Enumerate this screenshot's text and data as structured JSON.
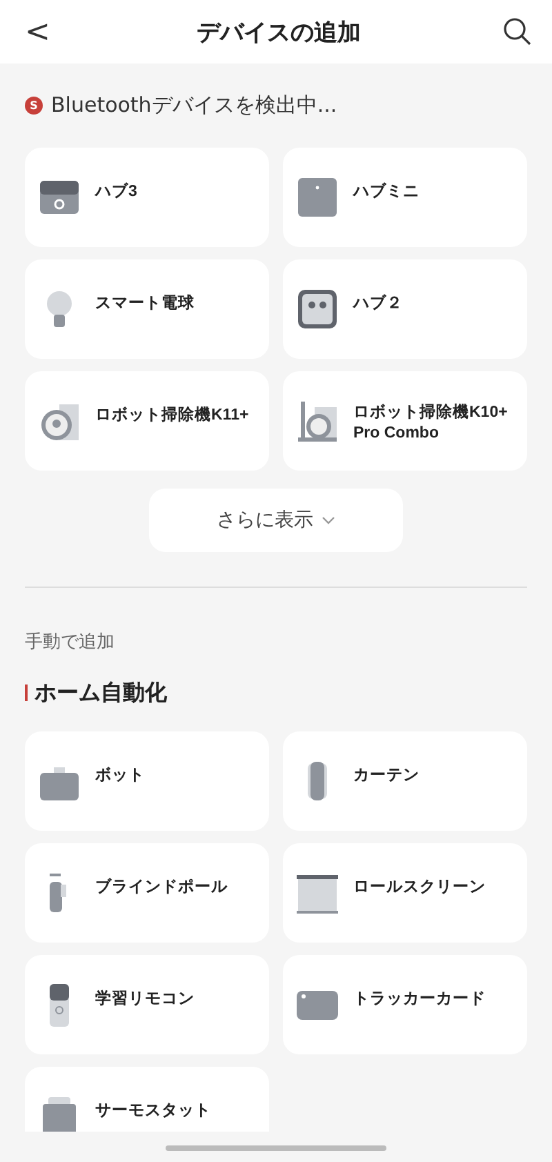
{
  "header": {
    "back": "<",
    "title": "デバイスの追加"
  },
  "scanning": {
    "badge": "S",
    "text": "Bluetoothデバイスを検出中..."
  },
  "found_devices": [
    {
      "name": "ハブ3",
      "kind": "hub3"
    },
    {
      "name": "ハブミニ",
      "kind": "hubmini"
    },
    {
      "name": "スマート電球",
      "kind": "bulb"
    },
    {
      "name": "ハブ２",
      "kind": "hub2"
    },
    {
      "name": "ロボット掃除機K11+",
      "kind": "robot"
    },
    {
      "name": "ロボット掃除機K10+ Pro Combo",
      "kind": "robotcombo"
    }
  ],
  "show_more": "さらに表示",
  "manual": {
    "label": "手動で追加",
    "section": "ホーム自動化",
    "devices": [
      {
        "name": "ボット",
        "kind": "bot"
      },
      {
        "name": "カーテン",
        "kind": "curtain"
      },
      {
        "name": "ブラインドポール",
        "kind": "blind"
      },
      {
        "name": "ロールスクリーン",
        "kind": "roller"
      },
      {
        "name": "学習リモコン",
        "kind": "remote"
      },
      {
        "name": "トラッカーカード",
        "kind": "card"
      },
      {
        "name": "サーモスタット",
        "kind": "thermo"
      }
    ]
  }
}
